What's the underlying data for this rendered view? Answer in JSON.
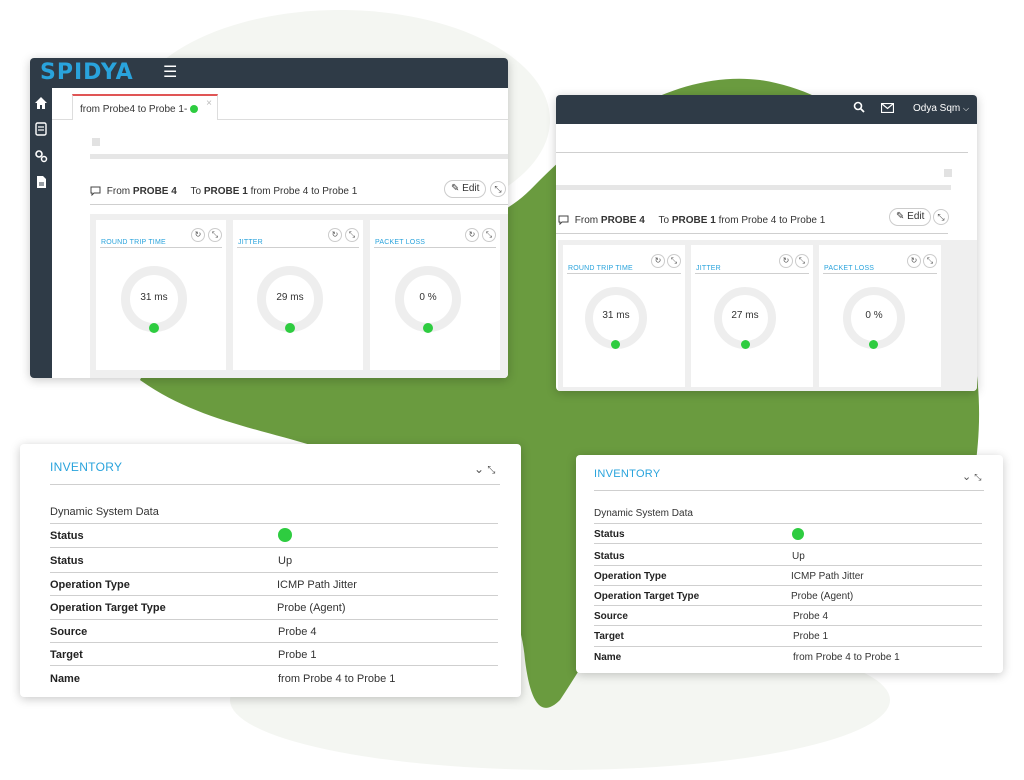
{
  "colors": {
    "accent": "#29a3dc",
    "topbar": "#2f3b47",
    "status_green": "#2ecc40",
    "background_blob": "#6a9b3f"
  },
  "window_left": {
    "logo": "SPIDYA",
    "menu_icon": "hamburger-icon",
    "sidebar_icons": [
      "home-icon",
      "list-icon",
      "settings-icon",
      "document-icon"
    ],
    "tab_label": "from Probe4 to Probe 1-",
    "header": {
      "from_prefix": "From",
      "from_probe": "PROBE 4",
      "to_prefix": "To",
      "to_probe": "PROBE 1",
      "suffix": "from Probe 4 to Probe 1"
    },
    "edit_label": "Edit",
    "metrics": [
      {
        "title": "ROUND TRIP TIME",
        "value": "31 ms"
      },
      {
        "title": "JITTER",
        "value": "29 ms"
      },
      {
        "title": "PACKET LOSS",
        "value": "0 %"
      }
    ]
  },
  "window_right": {
    "user_label": "Odya Sqm",
    "header": {
      "from_prefix": "From",
      "from_probe": "PROBE 4",
      "to_prefix": "To",
      "to_probe": "PROBE 1",
      "suffix": "from Probe 4 to Probe 1"
    },
    "edit_label": "Edit",
    "metrics": [
      {
        "title": "ROUND TRIP TIME",
        "value": "31 ms"
      },
      {
        "title": "JITTER",
        "value": "27 ms"
      },
      {
        "title": "PACKET LOSS",
        "value": "0 %"
      }
    ]
  },
  "inventory_left": {
    "title": "INVENTORY",
    "subtitle": "Dynamic System Data",
    "rows": [
      {
        "label": "Status",
        "value": ""
      },
      {
        "label": "Status",
        "value": "Up"
      },
      {
        "label": "Operation Type",
        "value": "ICMP Path Jitter"
      },
      {
        "label": "Operation Target Type",
        "value": "Probe (Agent)"
      },
      {
        "label": "Source",
        "value": "Probe 4"
      },
      {
        "label": "Target",
        "value": "Probe 1"
      },
      {
        "label": "Name",
        "value": "from Probe 4 to Probe 1"
      }
    ]
  },
  "inventory_right": {
    "title": "INVENTORY",
    "subtitle": "Dynamic System Data",
    "rows": [
      {
        "label": "Status",
        "value": ""
      },
      {
        "label": "Status",
        "value": "Up"
      },
      {
        "label": "Operation Type",
        "value": "ICMP Path Jitter"
      },
      {
        "label": "Operation Target Type",
        "value": "Probe (Agent)"
      },
      {
        "label": "Source",
        "value": "Probe 4"
      },
      {
        "label": "Target",
        "value": "Probe 1"
      },
      {
        "label": "Name",
        "value": "from Probe 4 to Probe 1"
      }
    ]
  }
}
